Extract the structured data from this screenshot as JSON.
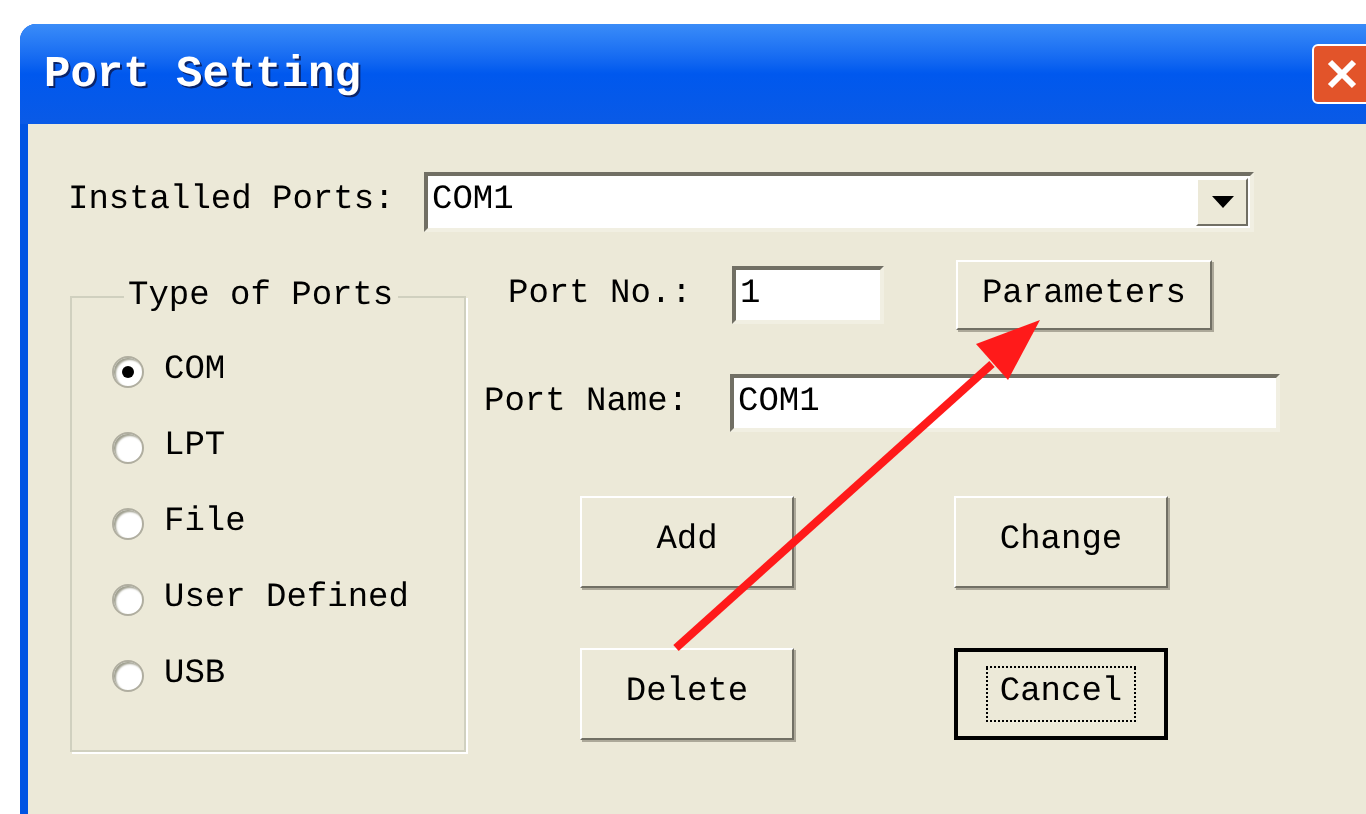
{
  "window": {
    "title": "Port Setting"
  },
  "installed_ports": {
    "label": "Installed Ports:",
    "value": "COM1"
  },
  "type_of_ports": {
    "label": "Type of Ports",
    "options": [
      {
        "label": "COM",
        "selected": true
      },
      {
        "label": "LPT",
        "selected": false
      },
      {
        "label": "File",
        "selected": false
      },
      {
        "label": "User Defined",
        "selected": false
      },
      {
        "label": "USB",
        "selected": false
      }
    ]
  },
  "port_no": {
    "label": "Port No.:",
    "value": "1"
  },
  "parameters_button": {
    "label": "Parameters"
  },
  "port_name": {
    "label": "Port Name:",
    "value": "COM1"
  },
  "buttons": [
    {
      "label": "Add",
      "focused": false
    },
    {
      "label": "Change",
      "focused": false
    },
    {
      "label": "Delete",
      "focused": false
    },
    {
      "label": "Cancel",
      "focused": true
    }
  ]
}
